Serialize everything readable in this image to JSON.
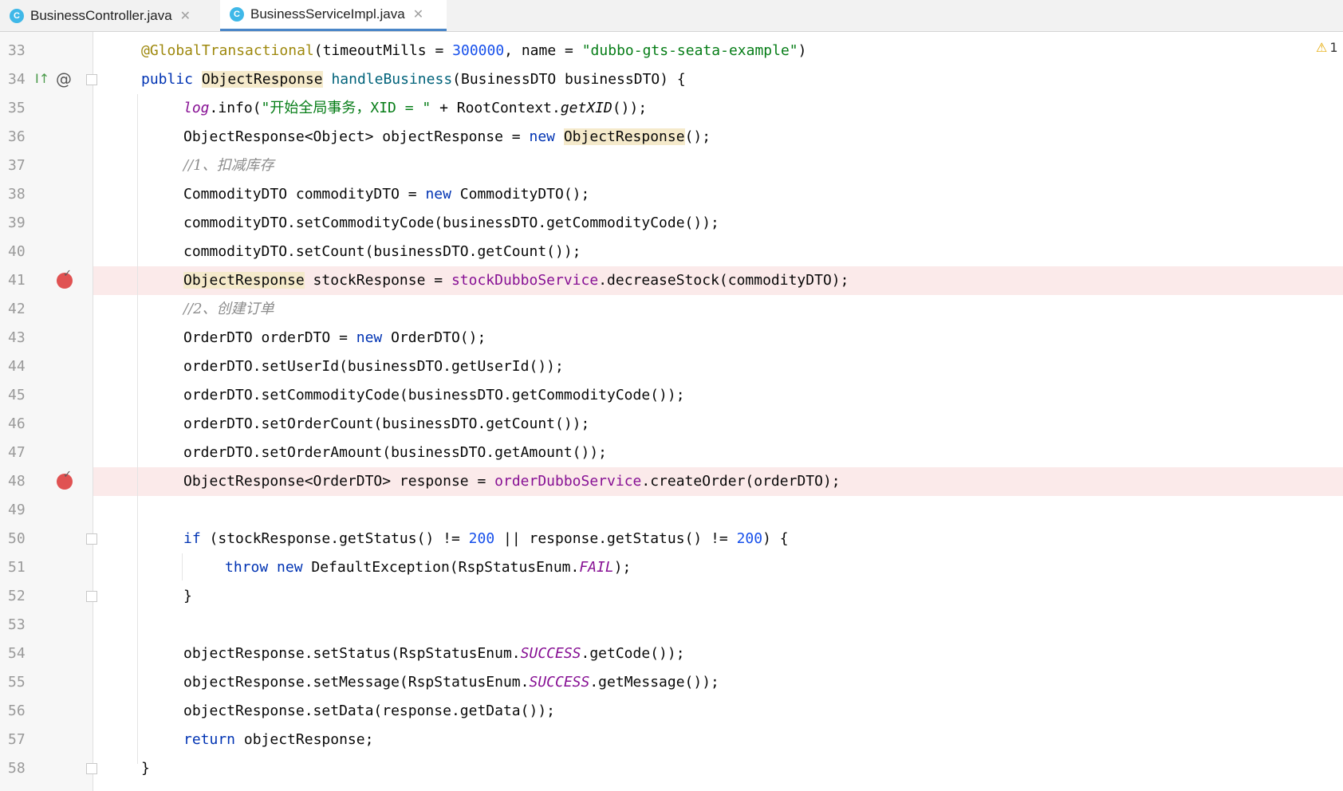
{
  "tabs": [
    {
      "label": "BusinessController.java",
      "icon": "C",
      "active": false
    },
    {
      "label": "BusinessServiceImpl.java",
      "icon": "C",
      "active": true
    }
  ],
  "warning_count": "1",
  "line_numbers": [
    "33",
    "34",
    "35",
    "36",
    "37",
    "38",
    "39",
    "40",
    "41",
    "42",
    "43",
    "44",
    "45",
    "46",
    "47",
    "48",
    "49",
    "50",
    "51",
    "52",
    "53",
    "54",
    "55",
    "56",
    "57",
    "58"
  ],
  "code": {
    "l33": {
      "ann": "@GlobalTransactional",
      "a": "(timeoutMills = ",
      "num": "300000",
      "b": ", name = ",
      "str": "\"dubbo-gts-seata-example\"",
      "c": ")"
    },
    "l34": {
      "kw": "public",
      "type": "ObjectResponse",
      "fn": "handleBusiness",
      "rest": "(BusinessDTO businessDTO) {"
    },
    "l35": {
      "field": "log",
      "a": ".info(",
      "str": "\"开始全局事务，XID = \"",
      "b": " + RootContext.",
      "ital": "getXID",
      "c": "());"
    },
    "l36": {
      "a": "ObjectResponse<Object> objectResponse = ",
      "kw": "new",
      "type": "ObjectResponse",
      "b": "();"
    },
    "l37": {
      "cmt": "//1、扣减库存"
    },
    "l38": {
      "a": "CommodityDTO commodityDTO = ",
      "kw": "new",
      "b": " CommodityDTO();"
    },
    "l39": {
      "a": "commodityDTO.setCommodityCode(businessDTO.getCommodityCode());"
    },
    "l40": {
      "a": "commodityDTO.setCount(businessDTO.getCount());"
    },
    "l41": {
      "type": "ObjectResponse",
      "a": " stockResponse = ",
      "field": "stockDubboService",
      "b": ".decreaseStock(commodityDTO);"
    },
    "l42": {
      "cmt": "//2、创建订单"
    },
    "l43": {
      "a": "OrderDTO orderDTO = ",
      "kw": "new",
      "b": " OrderDTO();"
    },
    "l44": {
      "a": "orderDTO.setUserId(businessDTO.getUserId());"
    },
    "l45": {
      "a": "orderDTO.setCommodityCode(businessDTO.getCommodityCode());"
    },
    "l46": {
      "a": "orderDTO.setOrderCount(businessDTO.getCount());"
    },
    "l47": {
      "a": "orderDTO.setOrderAmount(businessDTO.getAmount());"
    },
    "l48": {
      "a": "ObjectResponse<OrderDTO> response = ",
      "field": "orderDubboService",
      "b": ".createOrder(orderDTO);"
    },
    "l50": {
      "kw": "if",
      "a": " (stockResponse.getStatus() != ",
      "num1": "200",
      "b": " || response.getStatus() != ",
      "num2": "200",
      "c": ") {"
    },
    "l51": {
      "kw1": "throw",
      "kw2": "new",
      "a": " DefaultException(RspStatusEnum.",
      "ital": "FAIL",
      "b": ");"
    },
    "l52": {
      "a": "}"
    },
    "l54": {
      "a": "objectResponse.setStatus(RspStatusEnum.",
      "ital": "SUCCESS",
      "b": ".getCode());"
    },
    "l55": {
      "a": "objectResponse.setMessage(RspStatusEnum.",
      "ital": "SUCCESS",
      "b": ".getMessage());"
    },
    "l56": {
      "a": "objectResponse.setData(response.getData());"
    },
    "l57": {
      "kw": "return",
      "a": " objectResponse;"
    },
    "l58": {
      "a": "}"
    }
  }
}
